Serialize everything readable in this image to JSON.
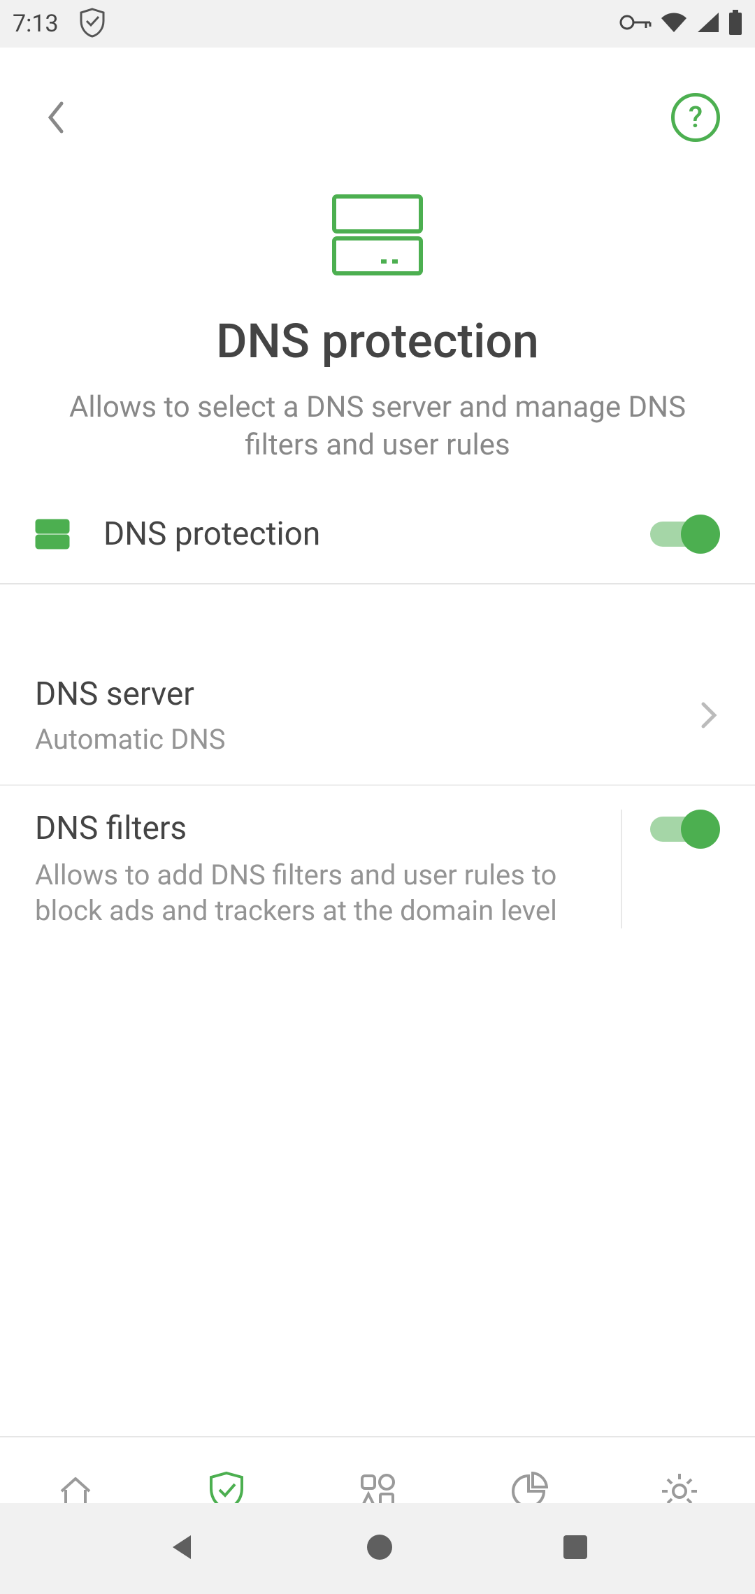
{
  "status": {
    "time": "7:13"
  },
  "appbar": {
    "help_glyph": "?"
  },
  "hero": {
    "title": "DNS protection",
    "subtitle": "Allows to select a DNS server and manage DNS filters and user rules"
  },
  "master": {
    "label": "DNS protection",
    "enabled": true
  },
  "server": {
    "title": "DNS server",
    "value": "Automatic DNS"
  },
  "filters": {
    "title": "DNS filters",
    "desc": "Allows to add DNS filters and user rules to block ads and trackers at the domain level",
    "enabled": true
  }
}
